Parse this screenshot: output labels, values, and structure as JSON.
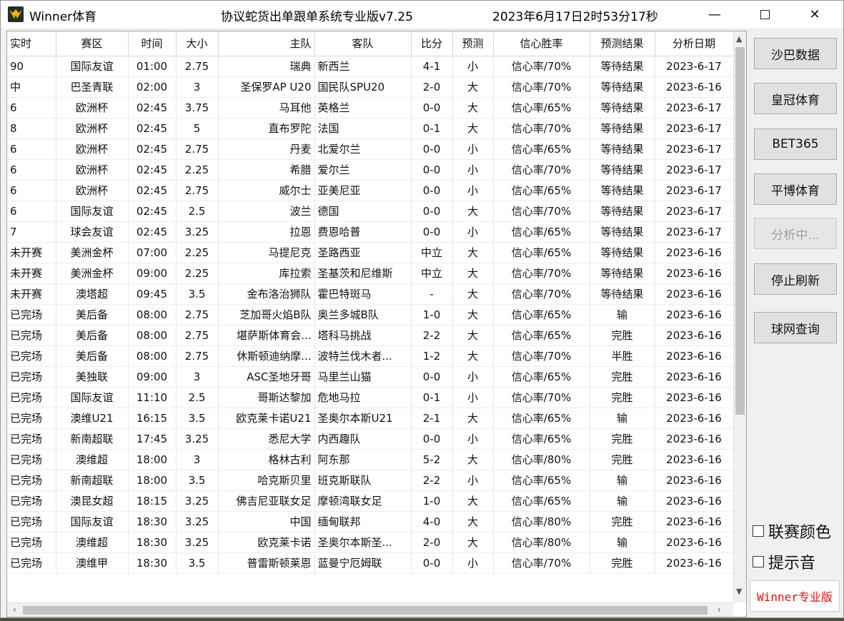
{
  "window": {
    "app_name": "Winner体育",
    "system_title": "协议蛇货出单跟单系统专业版v7.25",
    "datetime": "2023年6月17日2时53分17秒",
    "min_glyph": "—",
    "close_glyph": "✕"
  },
  "table": {
    "headers": [
      "实时",
      "赛区",
      "时间",
      "大小",
      "主队",
      "客队",
      "比分",
      "预测",
      "信心胜率",
      "预测结果",
      "分析日期"
    ],
    "rows": [
      [
        "90",
        "国际友谊",
        "01:00",
        "2.75",
        "瑞典",
        "新西兰",
        "4-1",
        "小",
        "信心率/70%",
        "等待结果",
        "2023-6-17"
      ],
      [
        "中",
        "巴圣青联",
        "02:00",
        "3",
        "圣保罗AP U20",
        "国民队SPU20",
        "2-0",
        "大",
        "信心率/70%",
        "等待结果",
        "2023-6-16"
      ],
      [
        "6",
        "欧洲杯",
        "02:45",
        "3.75",
        "马耳他",
        "英格兰",
        "0-0",
        "大",
        "信心率/65%",
        "等待结果",
        "2023-6-17"
      ],
      [
        "8",
        "欧洲杯",
        "02:45",
        "5",
        "直布罗陀",
        "法国",
        "0-1",
        "大",
        "信心率/70%",
        "等待结果",
        "2023-6-17"
      ],
      [
        "6",
        "欧洲杯",
        "02:45",
        "2.75",
        "丹麦",
        "北爱尔兰",
        "0-0",
        "小",
        "信心率/65%",
        "等待结果",
        "2023-6-17"
      ],
      [
        "6",
        "欧洲杯",
        "02:45",
        "2.25",
        "希腊",
        "爱尔兰",
        "0-0",
        "小",
        "信心率/70%",
        "等待结果",
        "2023-6-17"
      ],
      [
        "6",
        "欧洲杯",
        "02:45",
        "2.75",
        "威尔士",
        "亚美尼亚",
        "0-0",
        "小",
        "信心率/65%",
        "等待结果",
        "2023-6-17"
      ],
      [
        "6",
        "国际友谊",
        "02:45",
        "2.5",
        "波兰",
        "德国",
        "0-0",
        "大",
        "信心率/70%",
        "等待结果",
        "2023-6-17"
      ],
      [
        "7",
        "球会友谊",
        "02:45",
        "3.25",
        "拉恩",
        "费恩哈普",
        "0-0",
        "小",
        "信心率/65%",
        "等待结果",
        "2023-6-17"
      ],
      [
        "未开赛",
        "美洲金杯",
        "07:00",
        "2.25",
        "马提尼克",
        "圣路西亚",
        "中立",
        "大",
        "信心率/65%",
        "等待结果",
        "2023-6-16"
      ],
      [
        "未开赛",
        "美洲金杯",
        "09:00",
        "2.25",
        "库拉索",
        "圣基茨和尼维斯",
        "中立",
        "大",
        "信心率/70%",
        "等待结果",
        "2023-6-16"
      ],
      [
        "未开赛",
        "澳塔超",
        "09:45",
        "3.5",
        "金布洛治狮队",
        "霍巴特斑马",
        "-",
        "大",
        "信心率/70%",
        "等待结果",
        "2023-6-16"
      ],
      [
        "已完场",
        "美后备",
        "08:00",
        "2.75",
        "芝加哥火焰B队",
        "奥兰多城B队",
        "1-0",
        "大",
        "信心率/65%",
        "输",
        "2023-6-16"
      ],
      [
        "已完场",
        "美后备",
        "08:00",
        "2.75",
        "堪萨斯体育会...",
        "塔科马挑战",
        "2-2",
        "大",
        "信心率/65%",
        "完胜",
        "2023-6-16"
      ],
      [
        "已完场",
        "美后备",
        "08:00",
        "2.75",
        "休斯顿迪纳摩...",
        "波特兰伐木者...",
        "1-2",
        "大",
        "信心率/70%",
        "半胜",
        "2023-6-16"
      ],
      [
        "已完场",
        "美独联",
        "09:00",
        "3",
        "ASC圣地牙哥",
        "马里兰山猫",
        "0-0",
        "小",
        "信心率/65%",
        "完胜",
        "2023-6-16"
      ],
      [
        "已完场",
        "国际友谊",
        "11:10",
        "2.5",
        "哥斯达黎加",
        "危地马拉",
        "0-1",
        "小",
        "信心率/70%",
        "完胜",
        "2023-6-16"
      ],
      [
        "已完场",
        "澳维U21",
        "16:15",
        "3.5",
        "欧克莱卡诺U21",
        "圣奥尔本斯U21",
        "2-1",
        "大",
        "信心率/65%",
        "输",
        "2023-6-16"
      ],
      [
        "已完场",
        "新南超联",
        "17:45",
        "3.25",
        "悉尼大学",
        "内西趣队",
        "0-0",
        "小",
        "信心率/65%",
        "完胜",
        "2023-6-16"
      ],
      [
        "已完场",
        "澳维超",
        "18:00",
        "3",
        "格林古利",
        "阿东那",
        "5-2",
        "大",
        "信心率/80%",
        "完胜",
        "2023-6-16"
      ],
      [
        "已完场",
        "新南超联",
        "18:00",
        "3.5",
        "哈克斯贝里",
        "班克斯联队",
        "2-2",
        "小",
        "信心率/65%",
        "输",
        "2023-6-16"
      ],
      [
        "已完场",
        "澳昆女超",
        "18:15",
        "3.25",
        "佛吉尼亚联女足",
        "摩顿湾联女足",
        "1-0",
        "大",
        "信心率/65%",
        "输",
        "2023-6-16"
      ],
      [
        "已完场",
        "国际友谊",
        "18:30",
        "3.25",
        "中国",
        "缅甸联邦",
        "4-0",
        "大",
        "信心率/80%",
        "完胜",
        "2023-6-16"
      ],
      [
        "已完场",
        "澳维超",
        "18:30",
        "3.25",
        "欧克莱卡诺",
        "圣奥尔本斯圣...",
        "2-0",
        "大",
        "信心率/80%",
        "输",
        "2023-6-16"
      ],
      [
        "已完场",
        "澳维甲",
        "18:30",
        "3.5",
        "普雷斯顿莱恩",
        "蓝曼宁厄姆联",
        "0-0",
        "小",
        "信心率/70%",
        "完胜",
        "2023-6-16"
      ]
    ]
  },
  "scroll": {
    "up": "▲",
    "down": "▼",
    "left": "‹",
    "right": "›"
  },
  "sidebar": {
    "buttons": [
      "沙巴数据",
      "皇冠体育",
      "BET365",
      "平博体育",
      "分析中...",
      "停止刷新",
      "球网查询"
    ],
    "checkboxes": [
      "联赛颜色",
      "提示音"
    ],
    "badge": "Winner专业版"
  }
}
